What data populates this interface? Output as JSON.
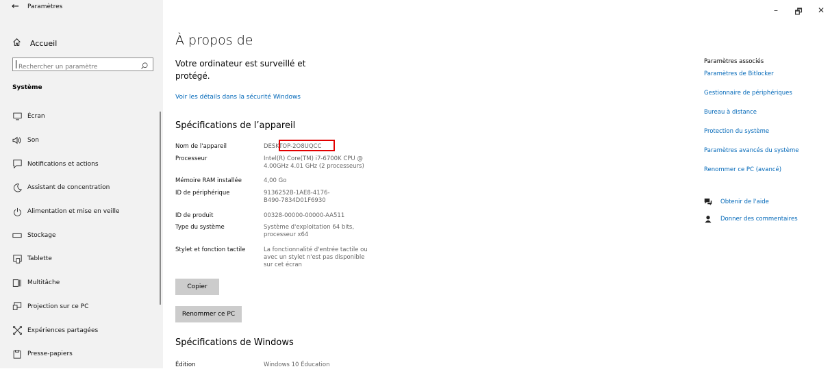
{
  "window": {
    "back_glyph": "←",
    "title": "Paramètres",
    "controls": {
      "minimize": "–",
      "restore": "🗗",
      "close": "✕"
    }
  },
  "sidebar": {
    "home_label": "Accueil",
    "search_placeholder": "Rechercher un paramètre",
    "section_title": "Système",
    "items": [
      {
        "label": "Écran",
        "icon": "monitor-icon"
      },
      {
        "label": "Son",
        "icon": "speaker-icon"
      },
      {
        "label": "Notifications et actions",
        "icon": "notification-icon"
      },
      {
        "label": "Assistant de concentration",
        "icon": "moon-icon"
      },
      {
        "label": "Alimentation et mise en veille",
        "icon": "power-icon"
      },
      {
        "label": "Stockage",
        "icon": "storage-icon"
      },
      {
        "label": "Tablette",
        "icon": "tablet-icon"
      },
      {
        "label": "Multitâche",
        "icon": "multitask-icon"
      },
      {
        "label": "Projection sur ce PC",
        "icon": "projection-icon"
      },
      {
        "label": "Expériences partagées",
        "icon": "shared-icon"
      },
      {
        "label": "Presse-papiers",
        "icon": "clipboard-icon"
      }
    ]
  },
  "main": {
    "title": "À propos de",
    "security_message": "Votre ordinateur est surveillé et protégé.",
    "security_link": "Voir les détails dans la sécurité Windows",
    "device_specs_title": "Spécifications de l’appareil",
    "device_specs": [
      {
        "label": "Nom de l'appareil",
        "value": "DESKTOP-2O8UQCC"
      },
      {
        "label": "Processeur",
        "value": "Intel(R) Core(TM) i7-6700K CPU @\n4.00GHz   4.01 GHz  (2 processeurs)"
      },
      {
        "label": "Mémoire RAM installée",
        "value": "4,00 Go"
      },
      {
        "label": "ID de périphérique",
        "value": "9136252B-1AE8-4176-\nB490-7834D01F6930"
      },
      {
        "label": "ID de produit",
        "value": "00328-00000-00000-AA511"
      },
      {
        "label": "Type du système",
        "value": "Système d'exploitation 64 bits,\nprocesseur x64"
      },
      {
        "label": "Stylet et fonction tactile",
        "value": "La fonctionnalité d'entrée tactile ou\navec un stylet n'est pas disponible\nsur cet écran"
      }
    ],
    "copy_button": "Copier",
    "rename_button": "Renommer ce PC",
    "windows_specs_title": "Spécifications de Windows",
    "edition_label": "Édition",
    "edition_value": "Windows 10 Éducation"
  },
  "right_panel": {
    "related_title": "Paramètres associés",
    "links": [
      "Paramètres de Bitlocker",
      "Gestionnaire de périphériques",
      "Bureau à distance",
      "Protection du système",
      "Paramètres avancés du système",
      "Renommer ce PC (avancé)"
    ],
    "help": [
      {
        "label": "Obtenir de l'aide",
        "icon": "help-chat-icon"
      },
      {
        "label": "Donner des commentaires",
        "icon": "feedback-icon"
      }
    ]
  },
  "colors": {
    "sidebar_bg": "#f2f2f2",
    "link": "#0067b8",
    "highlight_border": "#e20000",
    "button_bg": "#cccccc"
  }
}
